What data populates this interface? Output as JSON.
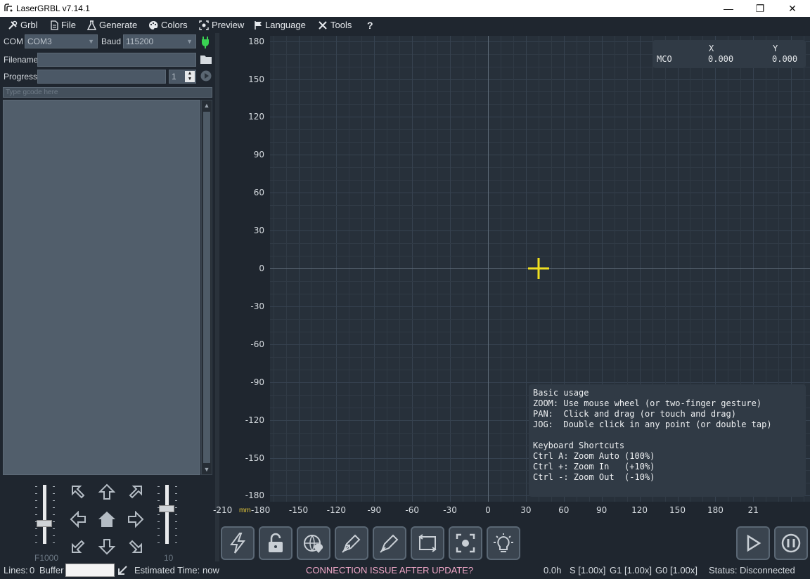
{
  "window": {
    "title": "LaserGRBL v7.14.1",
    "minimize": "—",
    "maximize": "❐",
    "close": "✕"
  },
  "menu": [
    {
      "label": "Grbl",
      "icon": "wrench-screwdriver-icon"
    },
    {
      "label": "File",
      "icon": "document-icon"
    },
    {
      "label": "Generate",
      "icon": "flask-icon"
    },
    {
      "label": "Colors",
      "icon": "palette-icon"
    },
    {
      "label": "Preview",
      "icon": "focus-icon"
    },
    {
      "label": "Language",
      "icon": "flag-icon"
    },
    {
      "label": "Tools",
      "icon": "tools-icon"
    },
    {
      "label": "?",
      "icon": "help-icon"
    }
  ],
  "connection": {
    "com_label": "COM",
    "com_value": "COM3",
    "baud_label": "Baud",
    "baud_value": "115200",
    "filename_label": "Filename",
    "filename_value": "",
    "progress_label": "Progress",
    "progress_value": "",
    "passes": "1",
    "gcode_placeholder": "Type gcode here"
  },
  "jog": {
    "feed_label": "F1000",
    "step_label": "10"
  },
  "coords": {
    "x_header": "X",
    "y_header": "Y",
    "row_label": "MCO",
    "x_value": "0.000",
    "y_value": "0.000"
  },
  "axes": {
    "unit": "mm",
    "y_ticks": [
      "180",
      "150",
      "120",
      "90",
      "60",
      "30",
      "0",
      "-30",
      "-60",
      "-90",
      "-120",
      "-150",
      "-180"
    ],
    "x_ticks": [
      "-210",
      "-180",
      "-150",
      "-120",
      "-90",
      "-60",
      "-30",
      "0",
      "30",
      "60",
      "90",
      "120",
      "150",
      "180",
      "21"
    ]
  },
  "help": {
    "lines": [
      "Basic usage",
      "ZOOM: Use mouse wheel (or two-finger gesture)",
      "PAN:  Click and drag (or touch and drag)",
      "JOG:  Double click in any point (or double tap)",
      "",
      "Keyboard Shortcuts",
      "Ctrl A: Zoom Auto (100%)",
      "Ctrl +: Zoom In   (+10%)",
      "Ctrl -: Zoom Out  (-10%)"
    ]
  },
  "toolbar": [
    "lightning-icon",
    "unlock-icon",
    "globe-pin-icon",
    "pen-arrow-icon",
    "pen-icon",
    "frame-arrows-icon",
    "focus-target-icon",
    "lightbulb-icon"
  ],
  "status": {
    "lines_label": "Lines:",
    "lines_value": "0",
    "buffer_label": "Buffer",
    "estimated_label": "Estimated Time:",
    "estimated_value": "now",
    "notice": "CONNECTION ISSUE AFTER UPDATE?",
    "time": "0.0h",
    "s_override": "S [1.00x]",
    "g1_override": "G1 [1.00x]",
    "g0_override": "G0 [1.00x]",
    "status_label": "Status:",
    "status_value": "Disconnected"
  },
  "colors": {
    "accent_yellow": "#f0e020",
    "notice_pink": "#f0a8c8",
    "connect_green": "#39d353"
  }
}
